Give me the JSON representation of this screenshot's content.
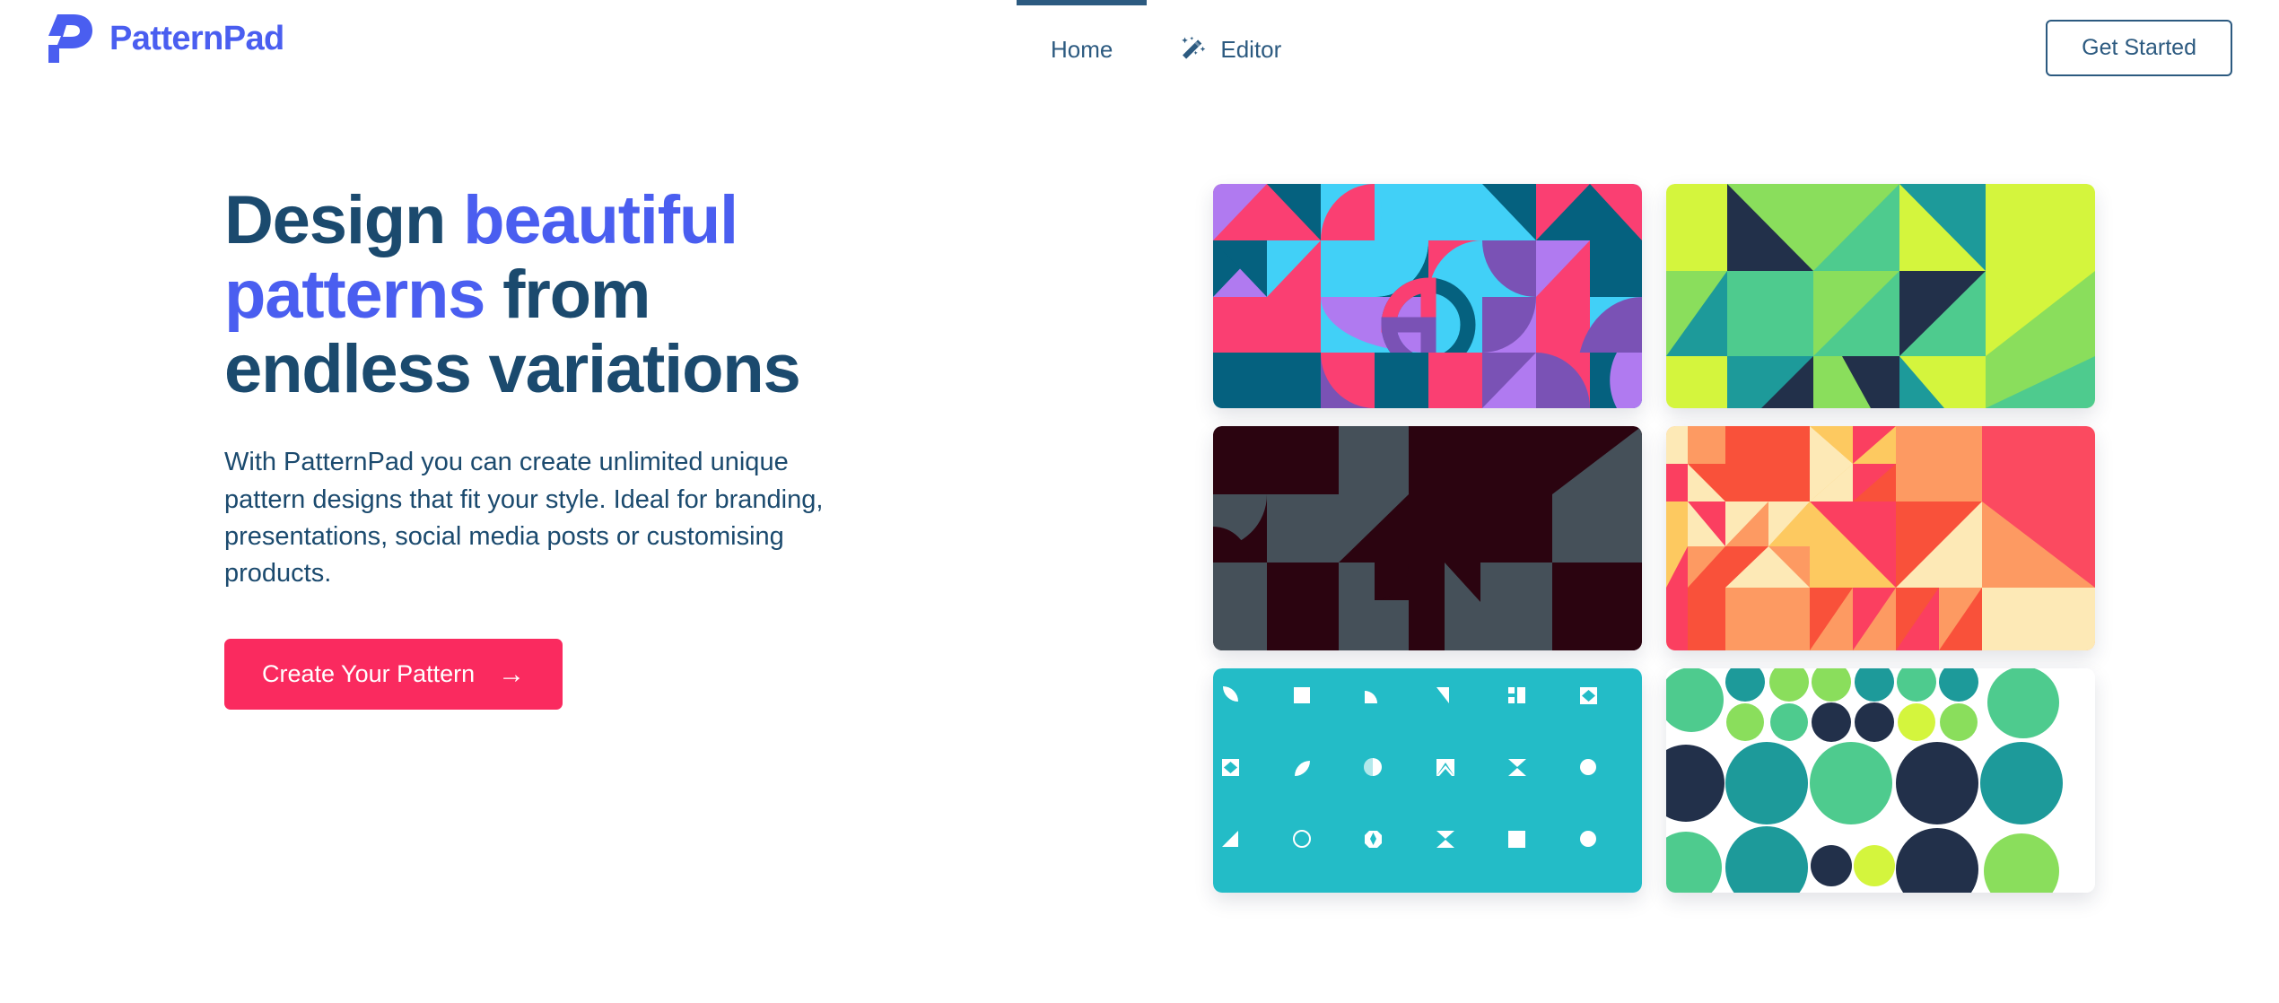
{
  "brand": {
    "name": "PatternPad",
    "logo_icon": "patternpad-p-logo",
    "color": "#4a5ef0"
  },
  "header": {
    "nav": [
      {
        "label": "Home",
        "icon": null,
        "active": true
      },
      {
        "label": "Editor",
        "icon": "magic-wand-icon",
        "active": false
      }
    ],
    "cta_label": "Get Started",
    "cta_border_color": "#2c5a80",
    "nav_text_color": "#2c5a80",
    "active_indicator_color": "#2c5a80"
  },
  "hero": {
    "headline_parts": [
      {
        "text": "Design ",
        "highlight": false
      },
      {
        "text": "beautiful patterns",
        "highlight": true
      },
      {
        "text": " from endless variations",
        "highlight": false
      }
    ],
    "headline_plain": "Design beautiful patterns from endless variations",
    "subtext": "With PatternPad you can create unlimited unique pattern designs that fit your style. Ideal for branding, presentations, social media posts or customising products.",
    "cta_label": "Create Your Pattern",
    "cta_arrow": "→",
    "cta_bg": "#fa2a5f",
    "heading_color": "#1b4a6e",
    "highlight_color": "#4a5ef0"
  },
  "patterns": [
    {
      "name": "geometric-pink-cyan",
      "style": "geometric-shapes",
      "palette": [
        "#fa3f72",
        "#41d0f7",
        "#b07af0",
        "#05617f",
        "#7a52b5"
      ]
    },
    {
      "name": "triangles-green",
      "style": "triangles",
      "palette": [
        "#d4f53d",
        "#8ade5c",
        "#4ecb8e",
        "#1d9a9a",
        "#22304a"
      ]
    },
    {
      "name": "geometric-dark",
      "style": "geometric-shapes",
      "palette": [
        "#2b0410",
        "#455059",
        "#1c0308"
      ]
    },
    {
      "name": "triangles-orange",
      "style": "triangles",
      "palette": [
        "#f9513a",
        "#fb6f4b",
        "#fd9a62",
        "#fdc960",
        "#fde9b6",
        "#fb3f60"
      ]
    },
    {
      "name": "glyph-grid-teal",
      "style": "icon-grid",
      "palette": [
        "#23bcc7",
        "#ffffff"
      ],
      "glyph_rows": 3,
      "glyph_cols": 6,
      "glyphs": [
        "leaf",
        "square",
        "quarter-round",
        "triangle-right",
        "split-blocks",
        "diamond-in-square",
        "diamond-in-square",
        "leaf",
        "half-circle",
        "arrow-up-box",
        "hourglass",
        "circle",
        "triangle-left",
        "circle-outline",
        "diamond-dot",
        "hourglass",
        "square",
        "circle"
      ]
    },
    {
      "name": "circles-green",
      "style": "circles",
      "palette": [
        "#4ecb8e",
        "#1d9a9a",
        "#8ade5c",
        "#d4f53d",
        "#22304a",
        "#ffffff"
      ]
    }
  ]
}
